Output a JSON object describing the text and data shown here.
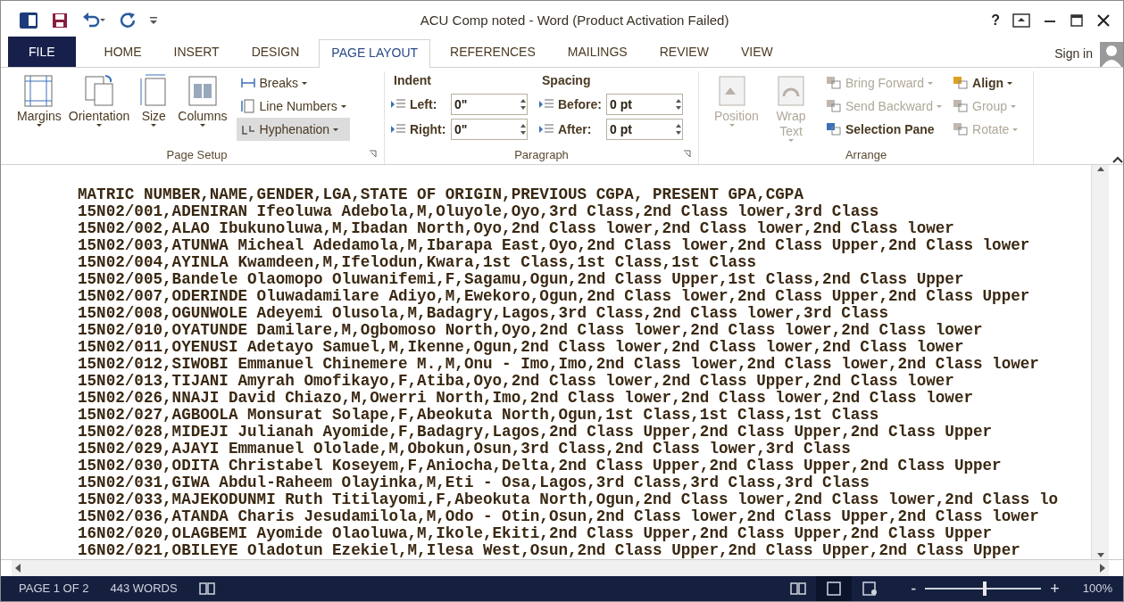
{
  "window": {
    "title": "ACU Comp noted - Word (Product Activation Failed)",
    "help": "?"
  },
  "tabs": [
    {
      "label": "FILE",
      "selected": false,
      "kind": "file"
    },
    {
      "label": "HOME",
      "selected": false,
      "kind": "tab"
    },
    {
      "label": "INSERT",
      "selected": false,
      "kind": "tab"
    },
    {
      "label": "DESIGN",
      "selected": false,
      "kind": "tab"
    },
    {
      "label": "PAGE LAYOUT",
      "selected": true,
      "kind": "tab"
    },
    {
      "label": "REFERENCES",
      "selected": false,
      "kind": "tab"
    },
    {
      "label": "MAILINGS",
      "selected": false,
      "kind": "tab"
    },
    {
      "label": "REVIEW",
      "selected": false,
      "kind": "tab"
    },
    {
      "label": "VIEW",
      "selected": false,
      "kind": "tab"
    }
  ],
  "sign_in": "Sign in",
  "page_setup": {
    "label": "Page Setup",
    "large_buttons": [
      {
        "label": "Margins"
      },
      {
        "label": "Orientation"
      },
      {
        "label": "Size"
      },
      {
        "label": "Columns"
      }
    ],
    "small_buttons": [
      {
        "label": "Breaks",
        "highlighted": false
      },
      {
        "label": "Line Numbers",
        "highlighted": false
      },
      {
        "label": "Hyphenation",
        "highlighted": true
      }
    ]
  },
  "paragraph": {
    "label": "Paragraph",
    "indent_label": "Indent",
    "spacing_label": "Spacing",
    "fields": [
      {
        "label": "Left:",
        "value": "0\""
      },
      {
        "label": "Right:",
        "value": "0\""
      },
      {
        "label": "Before:",
        "value": "0 pt"
      },
      {
        "label": "After:",
        "value": "0 pt"
      }
    ]
  },
  "arrange": {
    "label": "Arrange",
    "large_buttons": [
      {
        "label": "Position",
        "disabled": true
      },
      {
        "label": "Wrap Text",
        "disabled": true
      }
    ],
    "small_buttons": [
      {
        "label": "Bring Forward",
        "disabled": true
      },
      {
        "label": "Send Backward",
        "disabled": true
      },
      {
        "label": "Selection Pane",
        "disabled": false
      },
      {
        "label": "Align",
        "disabled": false
      },
      {
        "label": "Group",
        "disabled": true
      },
      {
        "label": "Rotate",
        "disabled": true
      }
    ]
  },
  "document_lines": [
    "MATRIC NUMBER,NAME,GENDER,LGA,STATE OF ORIGIN,PREVIOUS CGPA, PRESENT GPA,CGPA",
    "15N02/001,ADENIRAN Ifeoluwa Adebola,M,Oluyole,Oyo,3rd Class,2nd Class lower,3rd Class",
    "15N02/002,ALAO Ibukunoluwa,M,Ibadan North,Oyo,2nd Class lower,2nd Class lower,2nd Class lower",
    "15N02/003,ATUNWA Micheal Adedamola,M,Ibarapa East,Oyo,2nd Class lower,2nd Class Upper,2nd Class lower",
    "15N02/004,AYINLA Kwamdeen,M,Ifelodun,Kwara,1st Class,1st Class,1st Class",
    "15N02/005,Bandele Olaomopo Oluwanifemi,F,Sagamu,Ogun,2nd Class Upper,1st Class,2nd Class Upper",
    "15N02/007,ODERINDE Oluwadamilare Adiyo,M,Ewekoro,Ogun,2nd Class lower,2nd Class Upper,2nd Class Upper",
    "15N02/008,OGUNWOLE Adeyemi Olusola,M,Badagry,Lagos,3rd Class,2nd Class lower,3rd Class",
    "15N02/010,OYATUNDE Damilare,M,Ogbomoso North,Oyo,2nd Class lower,2nd Class lower,2nd Class lower",
    "15N02/011,OYENUSI Adetayo Samuel,M,Ikenne,Ogun,2nd Class lower,2nd Class lower,2nd Class lower",
    "15N02/012,SIWOBI Emmanuel Chinemere M.,M,Onu - Imo,Imo,2nd Class lower,2nd Class lower,2nd Class lower",
    "15N02/013,TIJANI Amyrah Omofikayo,F,Atiba,Oyo,2nd Class lower,2nd Class Upper,2nd Class lower",
    "15N02/026,NNAJI David Chiazo,M,Owerri North,Imo,2nd Class lower,2nd Class lower,2nd Class lower",
    "15N02/027,AGBOOLA Monsurat Solape,F,Abeokuta North,Ogun,1st Class,1st Class,1st Class",
    "15N02/028,MIDEJI Julianah Ayomide,F,Badagry,Lagos,2nd Class Upper,2nd Class Upper,2nd Class Upper",
    "15N02/029,AJAYI Emmanuel Ololade,M,Obokun,Osun,3rd Class,2nd Class lower,3rd Class",
    "15N02/030,ODITA Christabel Koseyem,F,Aniocha,Delta,2nd Class Upper,2nd Class Upper,2nd Class Upper",
    "15N02/031,GIWA Abdul-Raheem Olayinka,M,Eti - Osa,Lagos,3rd Class,3rd Class,3rd Class",
    "15N02/033,MAJEKODUNMI Ruth Titilayomi,F,Abeokuta North,Ogun,2nd Class lower,2nd Class lower,2nd Class lo",
    "15N02/036,ATANDA Charis Jesudamilola,M,Odo - Otin,Osun,2nd Class lower,2nd Class Upper,2nd Class lower",
    "16N02/020,OLAGBEMI Ayomide Olaoluwa,M,Ikole,Ekiti,2nd Class Upper,2nd Class Upper,2nd Class Upper",
    "16N02/021,OBILEYE Oladotun Ezekiel,M,Ilesa West,Osun,2nd Class Upper,2nd Class Upper,2nd Class Upper"
  ],
  "status_bar": {
    "page": "PAGE 1 OF 2",
    "words": "443 WORDS",
    "views": [
      {
        "kind": "read",
        "selected": false
      },
      {
        "kind": "print",
        "selected": true
      },
      {
        "kind": "web",
        "selected": false
      }
    ],
    "zoom_out": "-",
    "zoom_in": "+",
    "zoom": {
      "level": 0.51
    },
    "zoom_text": "100%"
  }
}
